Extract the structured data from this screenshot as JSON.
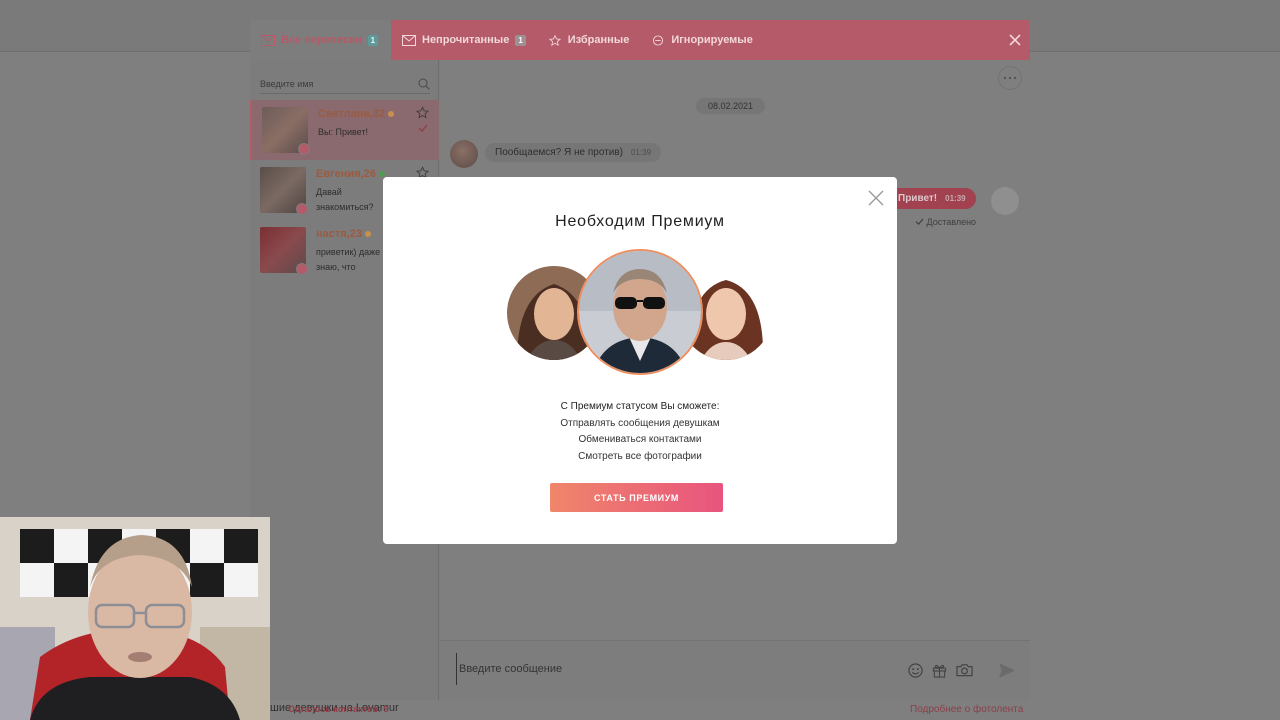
{
  "tabs": [
    {
      "label": "Все переписки",
      "badge": "1"
    },
    {
      "label": "Непрочитанные",
      "badge": "1"
    },
    {
      "label": "Избранные"
    },
    {
      "label": "Игнорируемые"
    }
  ],
  "search": {
    "placeholder": "Введите имя"
  },
  "contacts": [
    {
      "name": "Светлана,32",
      "message": "Вы: Привет!",
      "status_color": "#c9904a"
    },
    {
      "name": "Евгения,26",
      "message": "Давай знакомиться?",
      "status_color": "#4f9a4f"
    },
    {
      "name": "настя,23",
      "message": "приветик) даже знаю, что",
      "status_color": "#c9904a"
    }
  ],
  "contacts_left": "Осталось контактов: 9",
  "chat": {
    "date": "08.02.2021",
    "incoming": {
      "text": "Пообщаемся? Я не против)",
      "time": "01:39"
    },
    "outgoing": {
      "text": "Привет!",
      "time": "01:39",
      "status": "Доставлено"
    },
    "composer_placeholder": "Введите сообщение"
  },
  "footer": {
    "left_text": "шие девушки на Lovamur",
    "right_link": "Подробнее о фотолента"
  },
  "modal": {
    "title": "Необходим Премиум",
    "benefits_head": "С Премиум статусом Вы сможете:",
    "benefits": [
      "Отправлять сообщения девушкам",
      "Обмениваться контактами",
      "Смотреть все фотографии"
    ],
    "cta_label": "СТАТЬ ПРЕМИУМ"
  },
  "colors": {
    "accent": "#e8547e",
    "accent_orange": "#f0866a",
    "brand": "#b55a68"
  }
}
